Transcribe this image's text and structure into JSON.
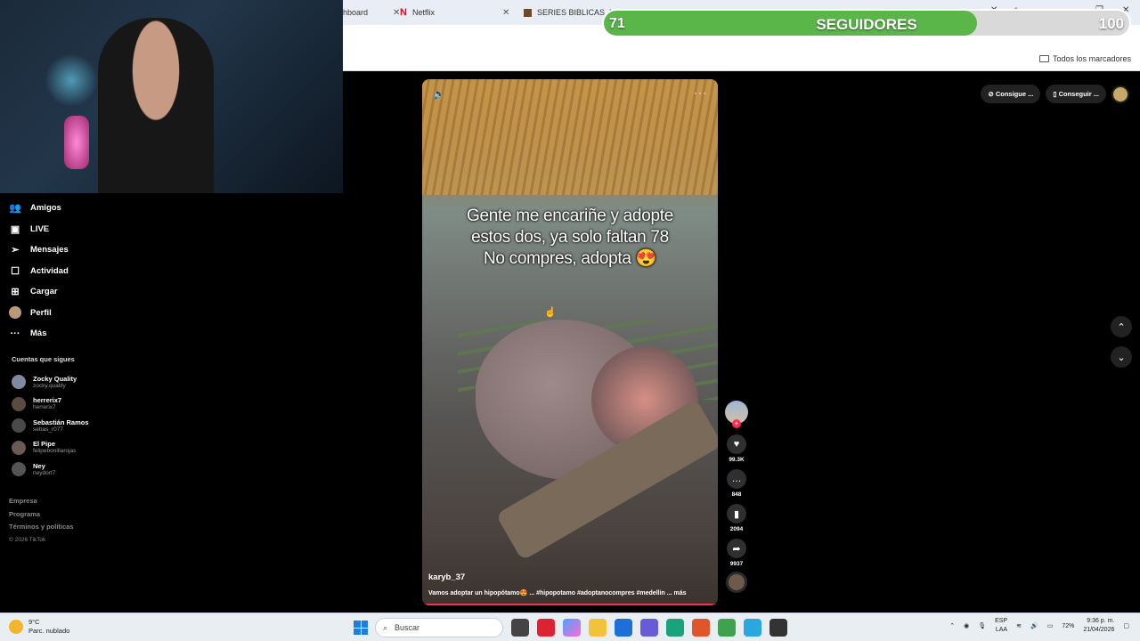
{
  "browser": {
    "tabs": [
      {
        "label": "hboard"
      },
      {
        "label": "Netflix"
      },
      {
        "label": "SERIES BIBLICAS .NET"
      }
    ],
    "bookmarks_label": "Todos los marcadores"
  },
  "followers_widget": {
    "current": "71",
    "label": "SEGUIDORES",
    "goal": "100",
    "progress_fraction": 0.71,
    "fill_color": "#5bb64a"
  },
  "sidebar": {
    "nav": [
      {
        "label": "Amigos",
        "icon": "friends-icon"
      },
      {
        "label": "LIVE",
        "icon": "live-icon"
      },
      {
        "label": "Mensajes",
        "icon": "messages-icon"
      },
      {
        "label": "Actividad",
        "icon": "activity-icon"
      },
      {
        "label": "Cargar",
        "icon": "upload-icon"
      },
      {
        "label": "Perfil",
        "icon": "profile-avatar"
      },
      {
        "label": "Más",
        "icon": "more-icon"
      }
    ],
    "following_title": "Cuentas que sigues",
    "following": [
      {
        "name": "Zocky Quality",
        "handle": "zocky.quality"
      },
      {
        "name": "herrerix7",
        "handle": "herrerix7"
      },
      {
        "name": "Sebastián Ramos",
        "handle": "sebas_r077"
      },
      {
        "name": "El Pipe",
        "handle": "felipebonillarojas"
      },
      {
        "name": "Ney",
        "handle": "neydort7"
      }
    ],
    "footer": [
      "Empresa",
      "Programa",
      "Términos y políticas"
    ],
    "copyright": "© 2026 TikTok"
  },
  "video": {
    "overlay_lines": [
      "Gente me encariñe y adopte",
      "estos dos, ya solo faltan 78",
      "No compres, adopta 😍"
    ],
    "username": "karyb_37",
    "description": "Vamos adoptar un hipopótamo😍 ... #hipopotamo #adoptanocompres #medellin ... más"
  },
  "actions": {
    "likes": "99.3K",
    "comments": "848",
    "saves": "2094",
    "shares": "9937"
  },
  "top_right": {
    "coins_label": "Consigue ...",
    "app_label": "Conseguir ..."
  },
  "taskbar": {
    "temp": "9°C",
    "weather": "Parc. nublado",
    "search_placeholder": "Buscar",
    "lang": "ESP",
    "lang2": "LAA",
    "battery": "72%",
    "time": "9:36 p. m.",
    "date": "21/04/2026"
  }
}
